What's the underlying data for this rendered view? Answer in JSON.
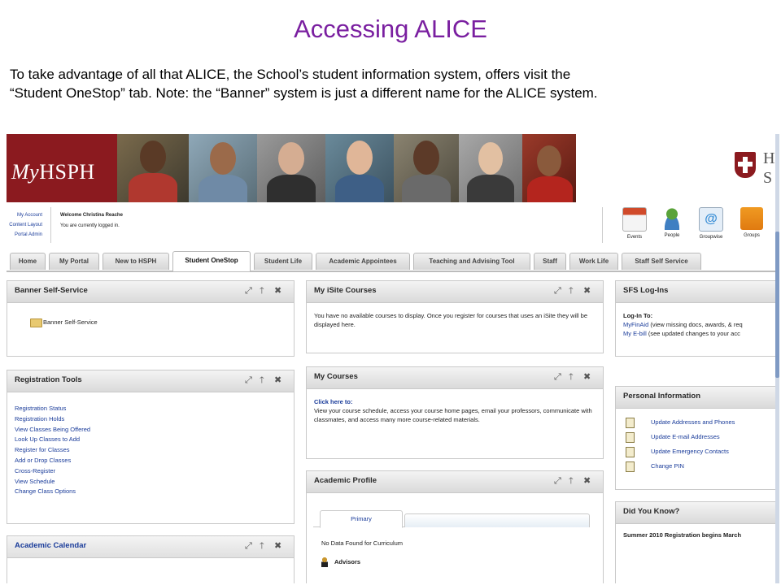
{
  "slide": {
    "title": "Accessing ALICE",
    "intro_line1": "To take advantage of all that ALICE, the School’s student information system, offers visit the",
    "intro_line2": "“Student OneStop” tab. Note: the “Banner” system is just a different name for the ALICE system."
  },
  "portal": {
    "logo": "MyHSPH",
    "harvard_letters": "H\nS",
    "account_links": [
      "My Account",
      "Content Layout",
      "Portal Admin"
    ],
    "welcome": "Welcome Christina Reache",
    "logged_in": "You are currently logged in.",
    "utilities": [
      {
        "label": "Events",
        "color": "#d04a2a"
      },
      {
        "label": "People",
        "color": "#5aa33a"
      },
      {
        "label": "Groupwise",
        "color": "#3b8fd6"
      },
      {
        "label": "Groups",
        "color": "#f09a22"
      }
    ],
    "tabs": [
      "Home",
      "My Portal",
      "New to HSPH",
      "Student OneStop",
      "Student Life",
      "Academic Appointees",
      "Teaching and Advising Tool",
      "Staff",
      "Work Life",
      "Staff Self Service"
    ],
    "active_tab": "Student OneStop",
    "portlet_controls": [
      "⤢",
      "🡑",
      "✖"
    ],
    "banner_self_service": {
      "title": "Banner Self-Service",
      "link": "Banner Self-Service"
    },
    "registration_tools": {
      "title": "Registration Tools",
      "links": [
        "Registration Status",
        "Registration Holds",
        "View Classes Being Offered",
        "Look Up Classes to Add",
        "Register for Classes",
        "Add or Drop Classes",
        "Cross-Register",
        "View Schedule",
        "Change Class Options"
      ]
    },
    "academic_calendar": {
      "title": "Academic Calendar"
    },
    "isite_courses": {
      "title": "My iSite Courses",
      "text": "You have no available courses to display. Once you register for courses that uses an iSite they will be displayed here."
    },
    "my_courses": {
      "title": "My Courses",
      "link": "Click here to:",
      "text": "View your course schedule, access your course home pages, email your professors, communicate with classmates, and access many more course-related materials."
    },
    "academic_profile": {
      "title": "Academic Profile",
      "tab": "Primary",
      "no_data": "No Data Found for Curriculum",
      "advisors": "Advisors"
    },
    "sfs_login": {
      "title": "SFS Log-Ins",
      "login_to": "Log-In To:",
      "myfinaid_link": "MyFinAid",
      "myfinaid_text": " (view missing docs, awards, & req",
      "ebill_link": "My E-bill",
      "ebill_text": " (see updated changes to your acc"
    },
    "personal_info": {
      "title": "Personal Information",
      "links": [
        "Update Addresses and Phones",
        "Update E-mail Addresses",
        "Update Emergency Contacts",
        "Change PIN"
      ]
    },
    "did_you_know": {
      "title": "Did You Know?",
      "text": "Summer 2010 Registration begins March"
    }
  }
}
